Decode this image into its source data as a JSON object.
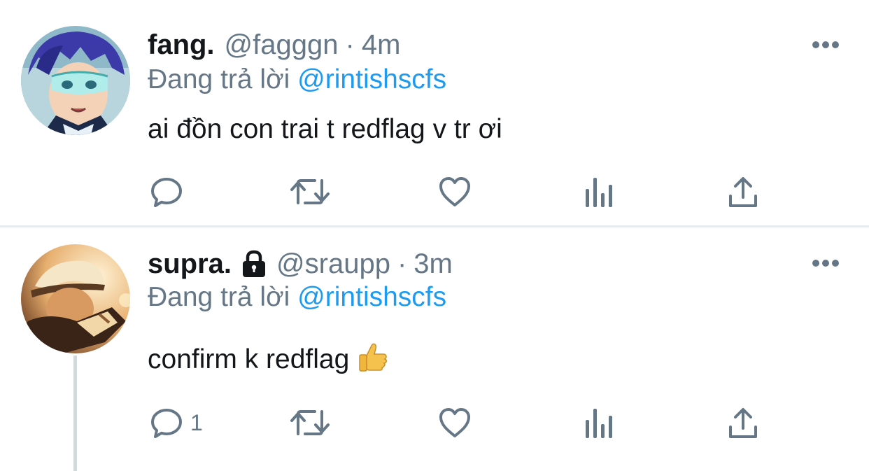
{
  "tweets": [
    {
      "display_name": "fang.",
      "handle": "@fagggn",
      "separator": "·",
      "time": "4m",
      "replying_prefix": "Đang trả lời ",
      "replying_to": "@rintishscfs",
      "text": "ai đồn con trai t redflag v tr ơi",
      "protected": false,
      "reply_count": "",
      "avatar_icon": "anime-avatar-blue-hair-visor"
    },
    {
      "display_name": "supra.",
      "handle": "@sraupp",
      "separator": "·",
      "time": "3m",
      "replying_prefix": "Đang trả lời ",
      "replying_to": "@rintishscfs",
      "text": "confirm k redflag",
      "emoji": "thumbs-up-emoji",
      "protected": true,
      "reply_count": "1",
      "avatar_icon": "anime-avatar-cap-warm-tones"
    }
  ],
  "colors": {
    "text": "#14171a",
    "secondary": "#657786",
    "mention": "#1d9bf0",
    "divider": "#e6ecf0"
  },
  "icons": [
    "reply-icon",
    "retweet-icon",
    "like-icon",
    "analytics-icon",
    "share-icon",
    "more-icon",
    "lock-icon"
  ]
}
